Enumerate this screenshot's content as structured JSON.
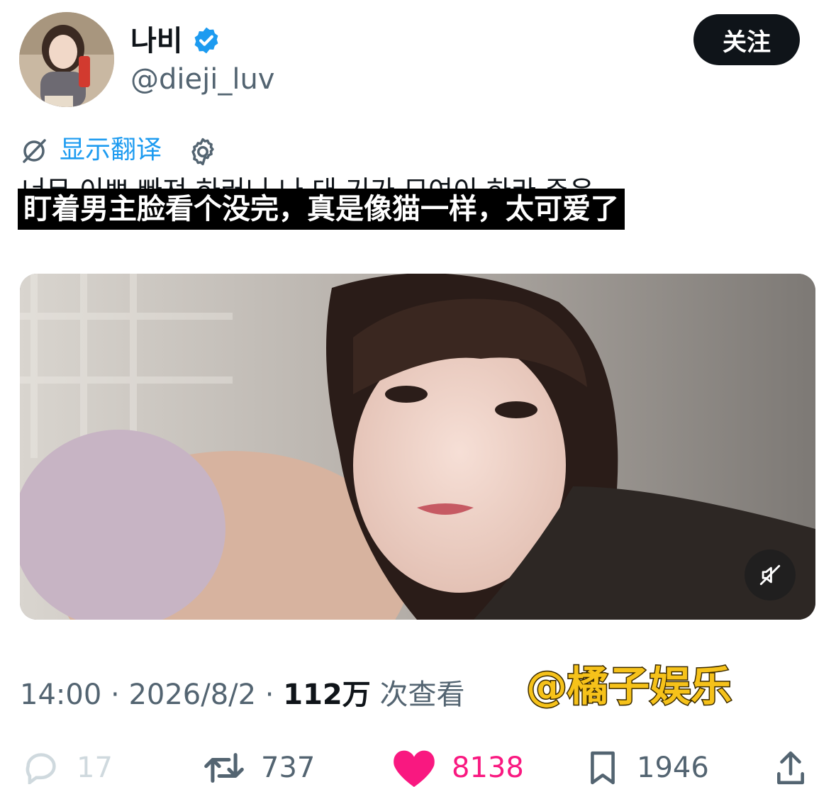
{
  "user": {
    "display_name": "나비",
    "handle": "@dieji_luv",
    "verified_icon": "verified-badge-icon",
    "follow_label": "关注"
  },
  "translate": {
    "label": "显示翻译",
    "icon": "translate-icon",
    "settings_icon": "gear-icon"
  },
  "tweet": {
    "text": "너무 이쁘 빠져 하러니 나 대 기가 모여이 하라 주은",
    "subtitle": "盯着男主脸看个没完，真是像猫一样，太可爱了"
  },
  "media": {
    "type": "video",
    "mute_icon": "muted-speaker-icon"
  },
  "meta": {
    "time": "14:00",
    "sep1": " · ",
    "date": "2026/8/2",
    "sep2": " · ",
    "views": "112万",
    "views_label": " 次查看"
  },
  "watermark": "@橘子娱乐",
  "actions": {
    "replies": "17",
    "reposts": "737",
    "likes": "8138",
    "bookmarks": "1946"
  },
  "colors": {
    "accent": "#1d9bf0",
    "like": "#f91880",
    "text": "#0f1419",
    "secondary": "#536471"
  }
}
